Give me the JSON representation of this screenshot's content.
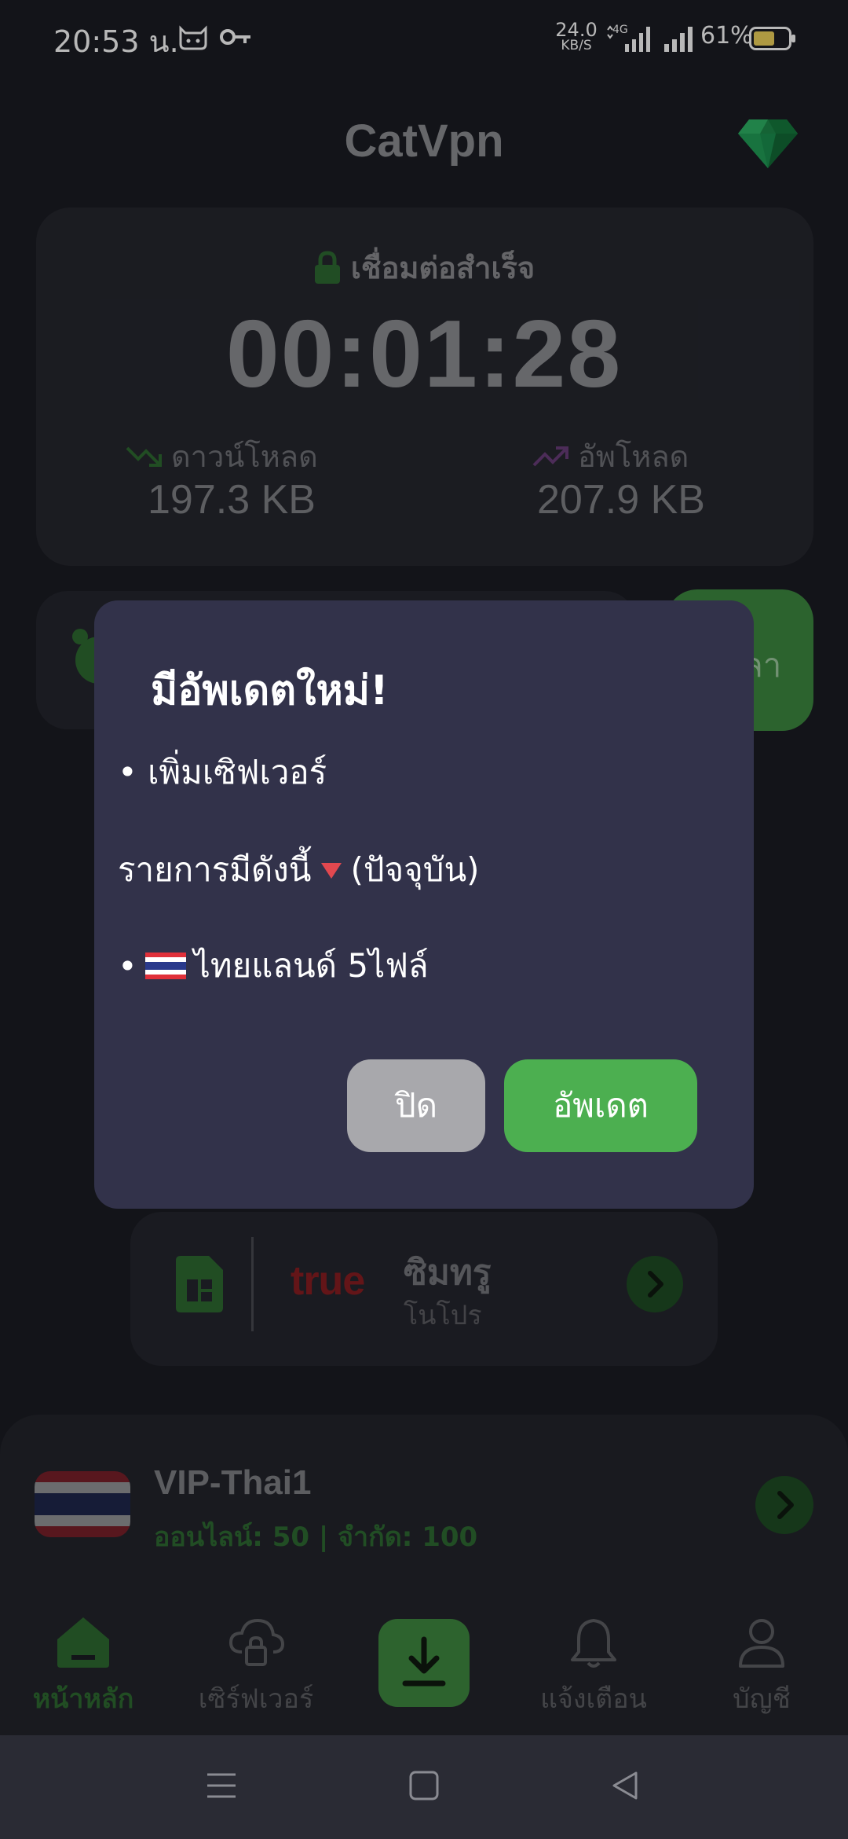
{
  "status_bar": {
    "time": "20:53 น.",
    "net_speed_value": "24.0",
    "net_speed_unit": "KB/S",
    "network_type": "4G",
    "battery": "61%"
  },
  "app": {
    "title": "CatVpn"
  },
  "connection": {
    "status": "เชื่อมต่อสำเร็จ",
    "timer": "00:01:28",
    "download_label": "ดาวน์โหลด",
    "download_value": "197.3 KB",
    "upload_label": "อัพโหลด",
    "upload_value": "207.9 KB"
  },
  "extend_button": {
    "label_partial": "ลา"
  },
  "sim": {
    "brand": "true",
    "name": "ซิมทรู",
    "plan": "โนโปร"
  },
  "server": {
    "name": "VIP-Thai1",
    "status": "ออนไลน์: 50 | จำกัด: 100"
  },
  "nav": {
    "home": "หน้าหลัก",
    "servers": "เซิร์ฟเวอร์",
    "notifications": "แจ้งเตือน",
    "account": "บัญชี"
  },
  "dialog": {
    "title": "มีอัพเดตใหม่!",
    "line1": "• เพิ่มเซิฟเวอร์",
    "line2_text": "รายการมีดังนี้",
    "line2_suffix": "(ปัจจุบัน)",
    "line3_bullet": "•",
    "line3_text": "ไทยแลนด์ 5ไฟล์",
    "close_label": "ปิด",
    "update_label": "อัพเดต"
  },
  "colors": {
    "accent_green": "#4caf50",
    "background": "#1b1c23",
    "dialog_bg": "#32324a"
  }
}
